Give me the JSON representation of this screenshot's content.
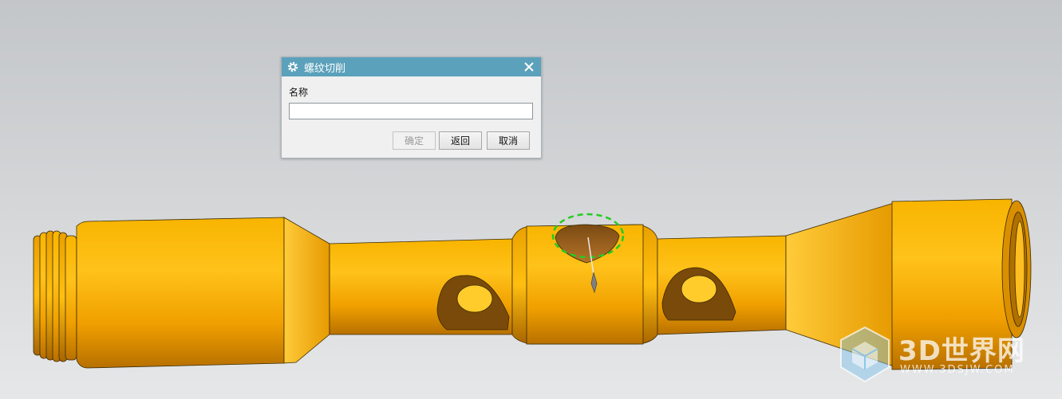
{
  "dialog": {
    "title": "螺纹切削",
    "field_label": "名称",
    "name_value": "",
    "name_placeholder": "",
    "buttons": {
      "ok": "确定",
      "back": "返回",
      "cancel": "取消"
    },
    "ok_enabled": false,
    "title_color": "#5ba1bb"
  },
  "model": {
    "part_color": "#f5a800",
    "highlight_color": "#22cc22"
  },
  "watermark": {
    "main": "3D世界网",
    "sub": "WWW.3DSJW.COM"
  }
}
